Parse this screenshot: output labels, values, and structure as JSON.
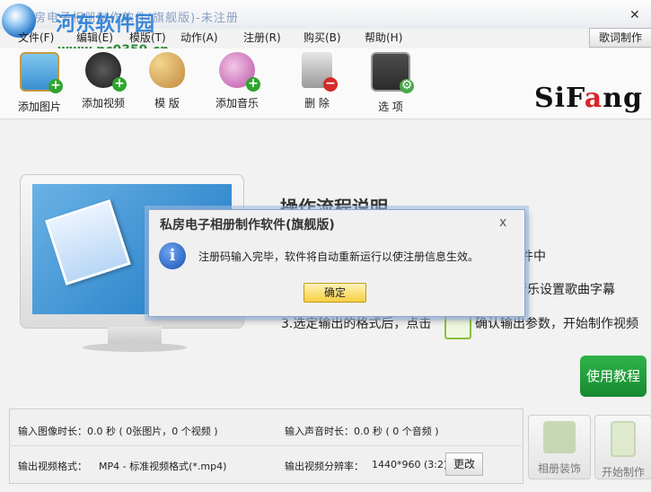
{
  "window": {
    "title": "私房电子相册制作软件(旗舰版)-未注册",
    "watermark": "河东软件园",
    "watermark_url": "www.pc0359.cn"
  },
  "menu": {
    "items": [
      "文件(F)",
      "编辑(E)",
      "模版(T)",
      "动作(A)",
      "注册(R)",
      "购买(B)",
      "帮助(H)"
    ],
    "lyric_button": "歌词制作"
  },
  "toolbar": {
    "buttons": [
      {
        "label": "添加图片",
        "icon": "add-image-icon"
      },
      {
        "label": "添加视频",
        "icon": "add-video-icon"
      },
      {
        "label": "模 版",
        "icon": "template-palette-icon"
      },
      {
        "label": "添加音乐",
        "icon": "add-music-icon"
      },
      {
        "label": "删 除",
        "icon": "delete-trash-icon"
      },
      {
        "label": "选 项",
        "icon": "options-icon"
      }
    ],
    "brand_left": "SiF",
    "brand_accent": "a",
    "brand_right": "ng"
  },
  "main": {
    "flow_title": "操作流程说明",
    "step1_tail": "件中",
    "step2_tail": "音乐设置歌曲字幕",
    "step3_head": "3.选定输出的格式后，点击",
    "step3_tail": "确认输出参数，开始制作视频",
    "tutorial_button": "使用教程"
  },
  "info": {
    "image_duration": "输入图像时长：0.0 秒 ( 0张图片，0 个视频 )",
    "audio_duration": "输入声音时长：0.0 秒 ( 0 个音频 )",
    "output_format_label": "输出视频格式：",
    "output_format_value": "MP4 - 标准视频格式(*.mp4)",
    "resolution_label": "输出视频分辨率：",
    "resolution_value": "1440*960 (3:2)",
    "change_button": "更改"
  },
  "actions": {
    "decorate_button": "相册装饰",
    "start_button": "开始制作"
  },
  "dialog": {
    "title": "私房电子相册制作软件(旗舰版)",
    "message": "注册码输入完毕，软件将自动重新运行以使注册信息生效。",
    "ok_button": "确定",
    "close": "x"
  },
  "colors": {
    "accent_green": "#2fb34a",
    "brand_red": "#d8262b",
    "ok_yellow": "#f7cf42",
    "watermark_blue": "#2b7fd6"
  }
}
